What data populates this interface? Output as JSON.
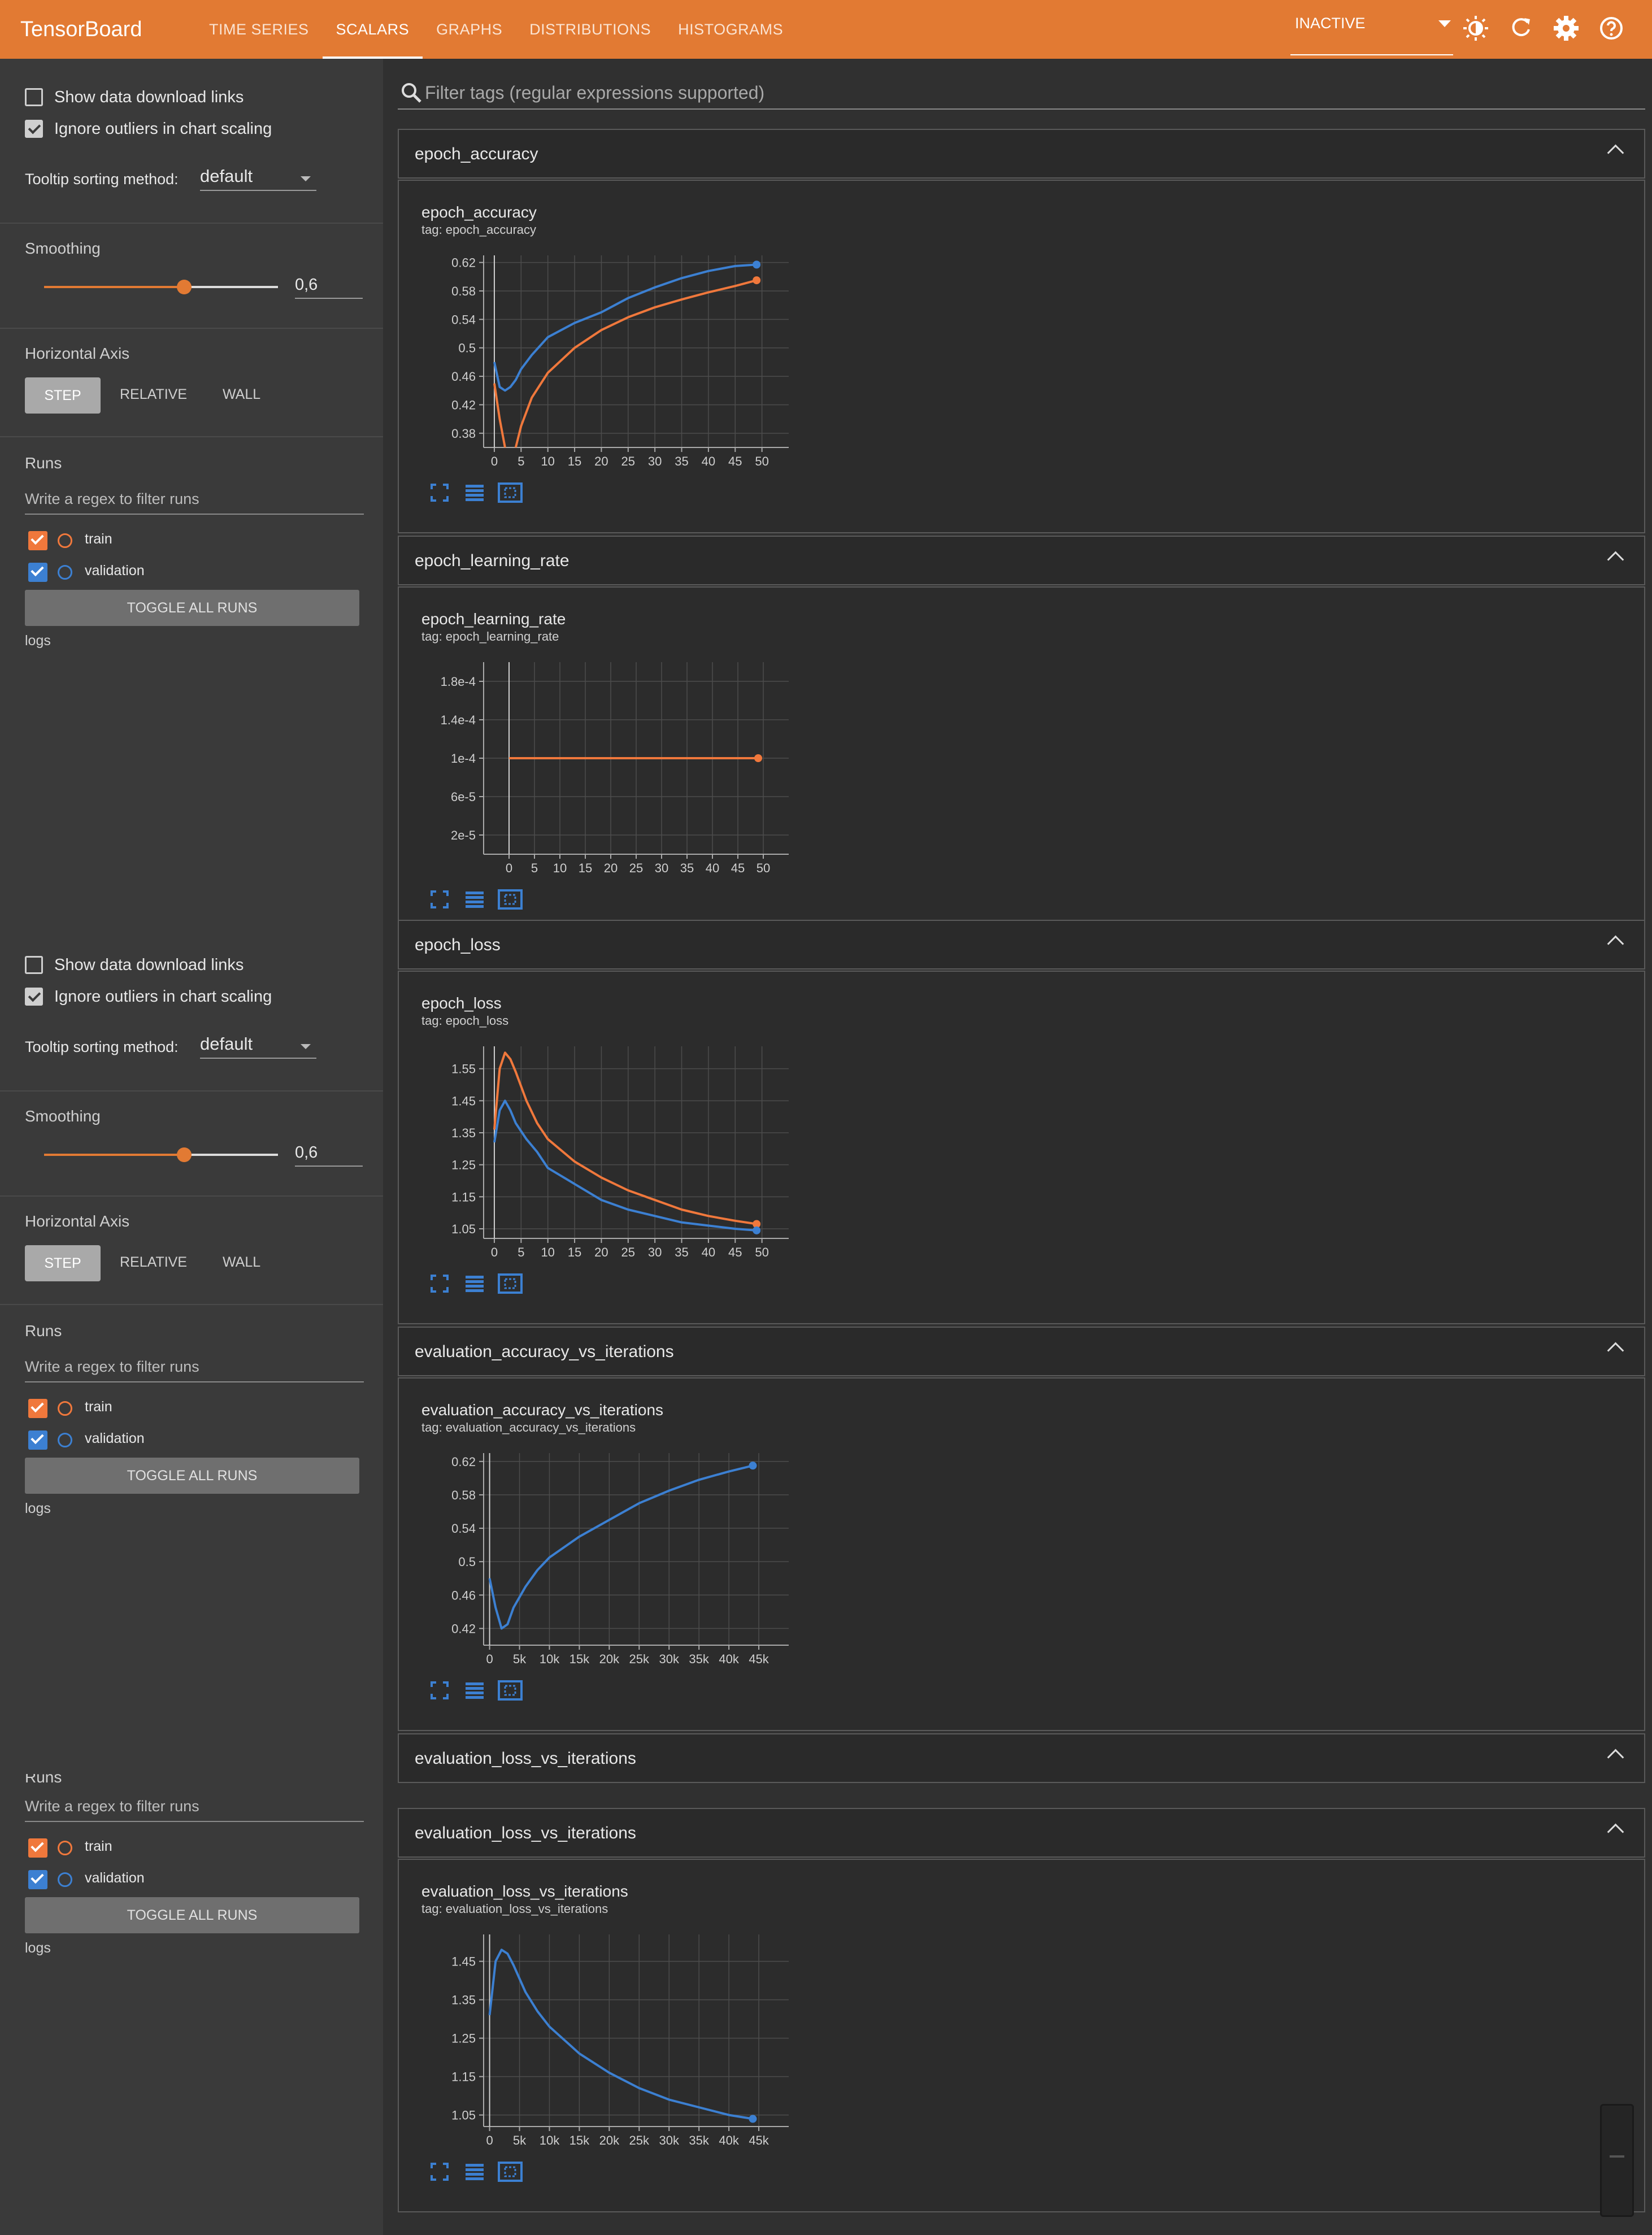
{
  "app": {
    "title": "TensorBoard"
  },
  "nav": {
    "tabs": [
      "TIME SERIES",
      "SCALARS",
      "GRAPHS",
      "DISTRIBUTIONS",
      "HISTOGRAMS"
    ],
    "active": "SCALARS"
  },
  "header": {
    "status": "INACTIVE"
  },
  "sidebar": {
    "show_download": "Show data download links",
    "ignore_outliers": "Ignore outliers in chart scaling",
    "tooltip_label": "Tooltip sorting method:",
    "tooltip_value": "default",
    "smoothing_label": "Smoothing",
    "smoothing_value": "0,6",
    "smoothing_level": 0.6,
    "axis_label": "Horizontal Axis",
    "axis_step": "STEP",
    "axis_relative": "RELATIVE",
    "axis_wall": "WALL",
    "runs_label": "Runs",
    "runs_placeholder": "Write a regex to filter runs",
    "run_train": "train",
    "run_validation": "validation",
    "toggle_all": "TOGGLE ALL RUNS",
    "logs": "logs",
    "runs_label_cut": "Runs"
  },
  "filter": {
    "placeholder": "Filter tags (regular expressions supported)"
  },
  "colors": {
    "accent": "#e27a33",
    "train": "#f0783c",
    "validation": "#3c80d2"
  },
  "cards": [
    {
      "head": "epoch_accuracy",
      "title": "epoch_accuracy",
      "tag": "tag: epoch_accuracy"
    },
    {
      "head": "epoch_learning_rate",
      "title": "epoch_learning_rate",
      "tag": "tag: epoch_learning_rate"
    },
    {
      "head": "epoch_loss",
      "title": "epoch_loss",
      "tag": "tag: epoch_loss"
    },
    {
      "head": "evaluation_accuracy_vs_iterations",
      "title": "evaluation_accuracy_vs_iterations",
      "tag": "tag: evaluation_accuracy_vs_iterations"
    },
    {
      "head": "evaluation_loss_vs_iterations"
    },
    {
      "head": "evaluation_loss_vs_iterations",
      "title": "evaluation_loss_vs_iterations",
      "tag": "tag: evaluation_loss_vs_iterations"
    }
  ],
  "chart_data": [
    {
      "type": "line",
      "title": "epoch_accuracy",
      "x_ticks": [
        "0",
        "5",
        "10",
        "15",
        "20",
        "25",
        "30",
        "35",
        "40",
        "45",
        "50"
      ],
      "y_ticks": [
        "0.62",
        "0.58",
        "0.54",
        "0.5",
        "0.46",
        "0.42",
        "0.38"
      ],
      "xlim": [
        -2,
        55
      ],
      "ylim": [
        0.36,
        0.63
      ],
      "series": [
        {
          "name": "train",
          "x": [
            0,
            1,
            2,
            3,
            4,
            5,
            7,
            10,
            15,
            20,
            25,
            30,
            35,
            40,
            45,
            49
          ],
          "y": [
            0.45,
            0.4,
            0.36,
            0.35,
            0.36,
            0.39,
            0.43,
            0.465,
            0.5,
            0.525,
            0.543,
            0.557,
            0.568,
            0.578,
            0.587,
            0.595
          ]
        },
        {
          "name": "validation",
          "x": [
            0,
            1,
            2,
            3,
            4,
            5,
            7,
            10,
            15,
            20,
            25,
            30,
            35,
            40,
            45,
            49
          ],
          "y": [
            0.48,
            0.445,
            0.44,
            0.445,
            0.455,
            0.47,
            0.49,
            0.515,
            0.535,
            0.55,
            0.57,
            0.585,
            0.598,
            0.608,
            0.615,
            0.617
          ]
        }
      ]
    },
    {
      "type": "line",
      "title": "epoch_learning_rate",
      "x_ticks": [
        "0",
        "5",
        "10",
        "15",
        "20",
        "25",
        "30",
        "35",
        "40",
        "45",
        "50"
      ],
      "y_ticks": [
        "1.8e-4",
        "1.4e-4",
        "1e-4",
        "6e-5",
        "2e-5"
      ],
      "xlim": [
        -5,
        55
      ],
      "ylim": [
        0,
        0.0002
      ],
      "series": [
        {
          "name": "train",
          "x": [
            0,
            49
          ],
          "y": [
            0.0001,
            0.0001
          ]
        }
      ]
    },
    {
      "type": "line",
      "title": "epoch_loss",
      "x_ticks": [
        "0",
        "5",
        "10",
        "15",
        "20",
        "25",
        "30",
        "35",
        "40",
        "45",
        "50"
      ],
      "y_ticks": [
        "1.55",
        "1.45",
        "1.35",
        "1.25",
        "1.15",
        "1.05"
      ],
      "xlim": [
        -2,
        55
      ],
      "ylim": [
        1.02,
        1.62
      ],
      "series": [
        {
          "name": "train",
          "x": [
            0,
            1,
            2,
            3,
            4,
            6,
            8,
            10,
            15,
            20,
            25,
            30,
            35,
            40,
            45,
            49
          ],
          "y": [
            1.36,
            1.55,
            1.6,
            1.58,
            1.54,
            1.45,
            1.38,
            1.33,
            1.26,
            1.21,
            1.17,
            1.14,
            1.11,
            1.09,
            1.075,
            1.065
          ]
        },
        {
          "name": "validation",
          "x": [
            0,
            1,
            2,
            3,
            4,
            6,
            8,
            10,
            15,
            20,
            25,
            30,
            35,
            40,
            45,
            49
          ],
          "y": [
            1.32,
            1.42,
            1.45,
            1.42,
            1.38,
            1.33,
            1.29,
            1.24,
            1.19,
            1.14,
            1.11,
            1.09,
            1.07,
            1.06,
            1.05,
            1.045
          ]
        }
      ]
    },
    {
      "type": "line",
      "title": "evaluation_accuracy_vs_iterations",
      "x_ticks": [
        "0",
        "5k",
        "10k",
        "15k",
        "20k",
        "25k",
        "30k",
        "35k",
        "40k",
        "45k"
      ],
      "y_ticks": [
        "0.62",
        "0.58",
        "0.54",
        "0.5",
        "0.46",
        "0.42"
      ],
      "xlim": [
        -1000,
        50000
      ],
      "ylim": [
        0.4,
        0.63
      ],
      "series": [
        {
          "name": "validation",
          "x": [
            0,
            1000,
            2000,
            3000,
            4000,
            6000,
            8000,
            10000,
            15000,
            20000,
            25000,
            30000,
            35000,
            40000,
            44000
          ],
          "y": [
            0.48,
            0.445,
            0.42,
            0.425,
            0.445,
            0.47,
            0.49,
            0.505,
            0.53,
            0.55,
            0.57,
            0.585,
            0.598,
            0.608,
            0.615
          ]
        }
      ]
    },
    {
      "type": "line",
      "title": "evaluation_loss_vs_iterations",
      "x_ticks": [
        "0",
        "5k",
        "10k",
        "15k",
        "20k",
        "25k",
        "30k",
        "35k",
        "40k",
        "45k"
      ],
      "y_ticks": [
        "1.45",
        "1.35",
        "1.25",
        "1.15",
        "1.05"
      ],
      "xlim": [
        -1000,
        50000
      ],
      "ylim": [
        1.02,
        1.52
      ],
      "series": [
        {
          "name": "validation",
          "x": [
            0,
            1000,
            2000,
            3000,
            4000,
            6000,
            8000,
            10000,
            15000,
            20000,
            25000,
            30000,
            35000,
            40000,
            44000
          ],
          "y": [
            1.31,
            1.45,
            1.48,
            1.47,
            1.44,
            1.37,
            1.32,
            1.28,
            1.21,
            1.16,
            1.12,
            1.09,
            1.07,
            1.05,
            1.04
          ]
        }
      ]
    }
  ]
}
